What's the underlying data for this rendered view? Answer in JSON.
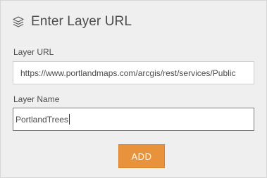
{
  "header": {
    "icon": "layers-icon",
    "title": "Enter Layer URL"
  },
  "fields": {
    "layer_url": {
      "label": "Layer URL",
      "value": "https://www.portlandmaps.com/arcgis/rest/services/Public"
    },
    "layer_name": {
      "label": "Layer Name",
      "value": "PortlandTrees"
    }
  },
  "actions": {
    "add_label": "ADD"
  },
  "colors": {
    "panel_bg": "#efefef",
    "accent": "#e8923b",
    "text": "#4c4c4c"
  }
}
